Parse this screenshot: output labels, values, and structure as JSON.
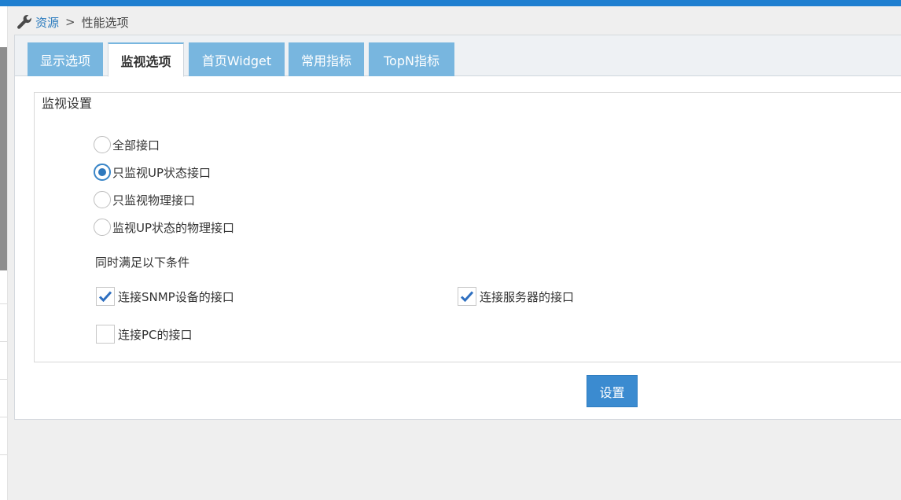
{
  "breadcrumb": {
    "root": "资源",
    "separator": ">",
    "current": "性能选项"
  },
  "tabs": [
    {
      "label": "显示选项",
      "active": false
    },
    {
      "label": "监视选项",
      "active": true
    },
    {
      "label": "首页Widget",
      "active": false
    },
    {
      "label": "常用指标",
      "active": false
    },
    {
      "label": "TopN指标",
      "active": false
    }
  ],
  "monitor": {
    "legend": "监视设置",
    "radios": [
      {
        "label": "全部接口",
        "checked": false
      },
      {
        "label": "只监视UP状态接口",
        "checked": true
      },
      {
        "label": "只监视物理接口",
        "checked": false
      },
      {
        "label": "监视UP状态的物理接口",
        "checked": false
      }
    ],
    "conditions_title": "同时满足以下条件",
    "checkboxes": [
      {
        "label": "连接SNMP设备的接口",
        "checked": true
      },
      {
        "label": "连接服务器的接口",
        "checked": true
      },
      {
        "label": "连接PC的接口",
        "checked": false
      }
    ]
  },
  "actions": {
    "set_label": "设置"
  },
  "colors": {
    "accent": "#1f7fd0",
    "tab": "#78b6df",
    "button": "#3b8bd0"
  }
}
